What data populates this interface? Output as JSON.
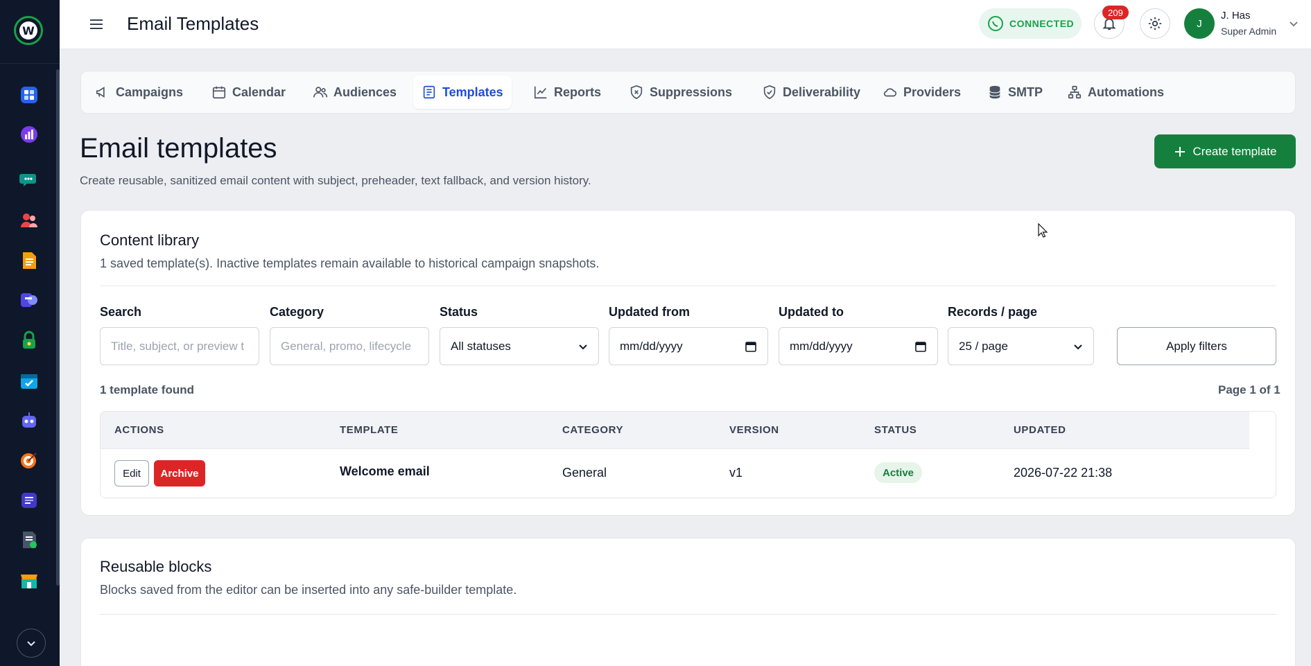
{
  "topbar": {
    "title": "Email Templates",
    "connection_status": "CONNECTED",
    "notification_count": "209",
    "user": {
      "initial": "J",
      "name": "J. Has",
      "role": "Super Admin"
    }
  },
  "tabs": [
    {
      "label": "Campaigns",
      "icon": "megaphone-icon"
    },
    {
      "label": "Calendar",
      "icon": "calendar-icon"
    },
    {
      "label": "Audiences",
      "icon": "users-icon"
    },
    {
      "label": "Templates",
      "icon": "document-icon",
      "active": true
    },
    {
      "label": "Reports",
      "icon": "trend-icon"
    },
    {
      "label": "Suppressions",
      "icon": "shield-x-icon"
    },
    {
      "label": "Deliverability",
      "icon": "shield-check-icon"
    },
    {
      "label": "Providers",
      "icon": "cloud-icon"
    },
    {
      "label": "SMTP",
      "icon": "database-icon"
    },
    {
      "label": "Automations",
      "icon": "flow-icon"
    }
  ],
  "header": {
    "title": "Email templates",
    "subtitle": "Create reusable, sanitized email content with subject, preheader, text fallback, and version history.",
    "create_label": "Create template"
  },
  "library": {
    "title": "Content library",
    "subtitle": "1 saved template(s). Inactive templates remain available to historical campaign snapshots.",
    "filters": {
      "search": {
        "label": "Search",
        "placeholder": "Title, subject, or preview t"
      },
      "category": {
        "label": "Category",
        "placeholder": "General, promo, lifecycle"
      },
      "status": {
        "label": "Status",
        "value": "All statuses"
      },
      "updated_from": {
        "label": "Updated from",
        "value": "mm/dd/yyyy"
      },
      "updated_to": {
        "label": "Updated to",
        "value": "mm/dd/yyyy"
      },
      "records": {
        "label": "Records / page",
        "value": "25 / page"
      },
      "apply_label": "Apply filters"
    },
    "count_text": "1 template found",
    "page_text": "Page 1 of 1",
    "columns": [
      "ACTIONS",
      "TEMPLATE",
      "CATEGORY",
      "VERSION",
      "STATUS",
      "UPDATED"
    ],
    "rows": [
      {
        "edit_label": "Edit",
        "archive_label": "Archive",
        "template": "Welcome email",
        "category": "General",
        "version": "v1",
        "status": "Active",
        "updated": "2026-07-22 21:38"
      }
    ]
  },
  "blocks": {
    "title": "Reusable blocks",
    "subtitle": "Blocks saved from the editor can be inserted into any safe-builder template."
  },
  "colors": {
    "sidebar_bg": "#0f172a",
    "brand_green": "#15803d",
    "accent_blue": "#1d4ed8",
    "danger": "#dc2626"
  }
}
